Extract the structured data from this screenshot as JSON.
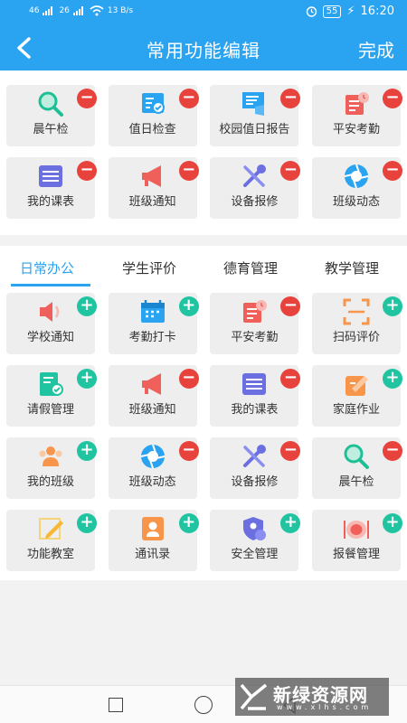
{
  "status_bar": {
    "signal_text": "46",
    "signal2_text": "26",
    "speed": "13 B/s",
    "battery": "55",
    "time": "16:20"
  },
  "header": {
    "title": "常用功能编辑",
    "done_label": "完成"
  },
  "colors": {
    "primary": "#2aa3f0",
    "remove": "#e8423d",
    "add": "#21c4a0"
  },
  "common_functions": [
    {
      "label": "晨午检",
      "icon": "magnifier-icon",
      "action": "remove"
    },
    {
      "label": "值日检查",
      "icon": "checklist-icon",
      "action": "remove"
    },
    {
      "label": "校园值日报告",
      "icon": "report-icon",
      "action": "remove"
    },
    {
      "label": "平安考勤",
      "icon": "attendance-icon",
      "action": "remove"
    },
    {
      "label": "我的课表",
      "icon": "schedule-icon",
      "action": "remove"
    },
    {
      "label": "班级通知",
      "icon": "megaphone-icon",
      "action": "remove"
    },
    {
      "label": "设备报修",
      "icon": "tools-icon",
      "action": "remove"
    },
    {
      "label": "班级动态",
      "icon": "aperture-icon",
      "action": "remove"
    }
  ],
  "tabs": [
    {
      "label": "日常办公",
      "active": true
    },
    {
      "label": "学生评价",
      "active": false
    },
    {
      "label": "德育管理",
      "active": false
    },
    {
      "label": "教学管理",
      "active": false
    }
  ],
  "daily_office": [
    {
      "label": "学校通知",
      "icon": "speaker-icon",
      "action": "add"
    },
    {
      "label": "考勤打卡",
      "icon": "calendar-icon",
      "action": "add"
    },
    {
      "label": "平安考勤",
      "icon": "attendance-icon",
      "action": "remove"
    },
    {
      "label": "扫码评价",
      "icon": "scan-icon",
      "action": "add"
    },
    {
      "label": "请假管理",
      "icon": "leave-icon",
      "action": "add"
    },
    {
      "label": "班级通知",
      "icon": "megaphone-icon",
      "action": "remove"
    },
    {
      "label": "我的课表",
      "icon": "schedule-icon",
      "action": "remove"
    },
    {
      "label": "家庭作业",
      "icon": "homework-icon",
      "action": "add"
    },
    {
      "label": "我的班级",
      "icon": "people-icon",
      "action": "add"
    },
    {
      "label": "班级动态",
      "icon": "aperture-icon",
      "action": "remove"
    },
    {
      "label": "设备报修",
      "icon": "tools-icon",
      "action": "remove"
    },
    {
      "label": "晨午检",
      "icon": "magnifier-icon",
      "action": "remove"
    },
    {
      "label": "功能教室",
      "icon": "pencil-icon",
      "action": "add"
    },
    {
      "label": "通讯录",
      "icon": "contacts-icon",
      "action": "add"
    },
    {
      "label": "安全管理",
      "icon": "security-icon",
      "action": "add"
    },
    {
      "label": "报餐管理",
      "icon": "dish-icon",
      "action": "add"
    }
  ],
  "watermark": {
    "text": "新绿资源网",
    "sub": "www.xlhs.com"
  }
}
